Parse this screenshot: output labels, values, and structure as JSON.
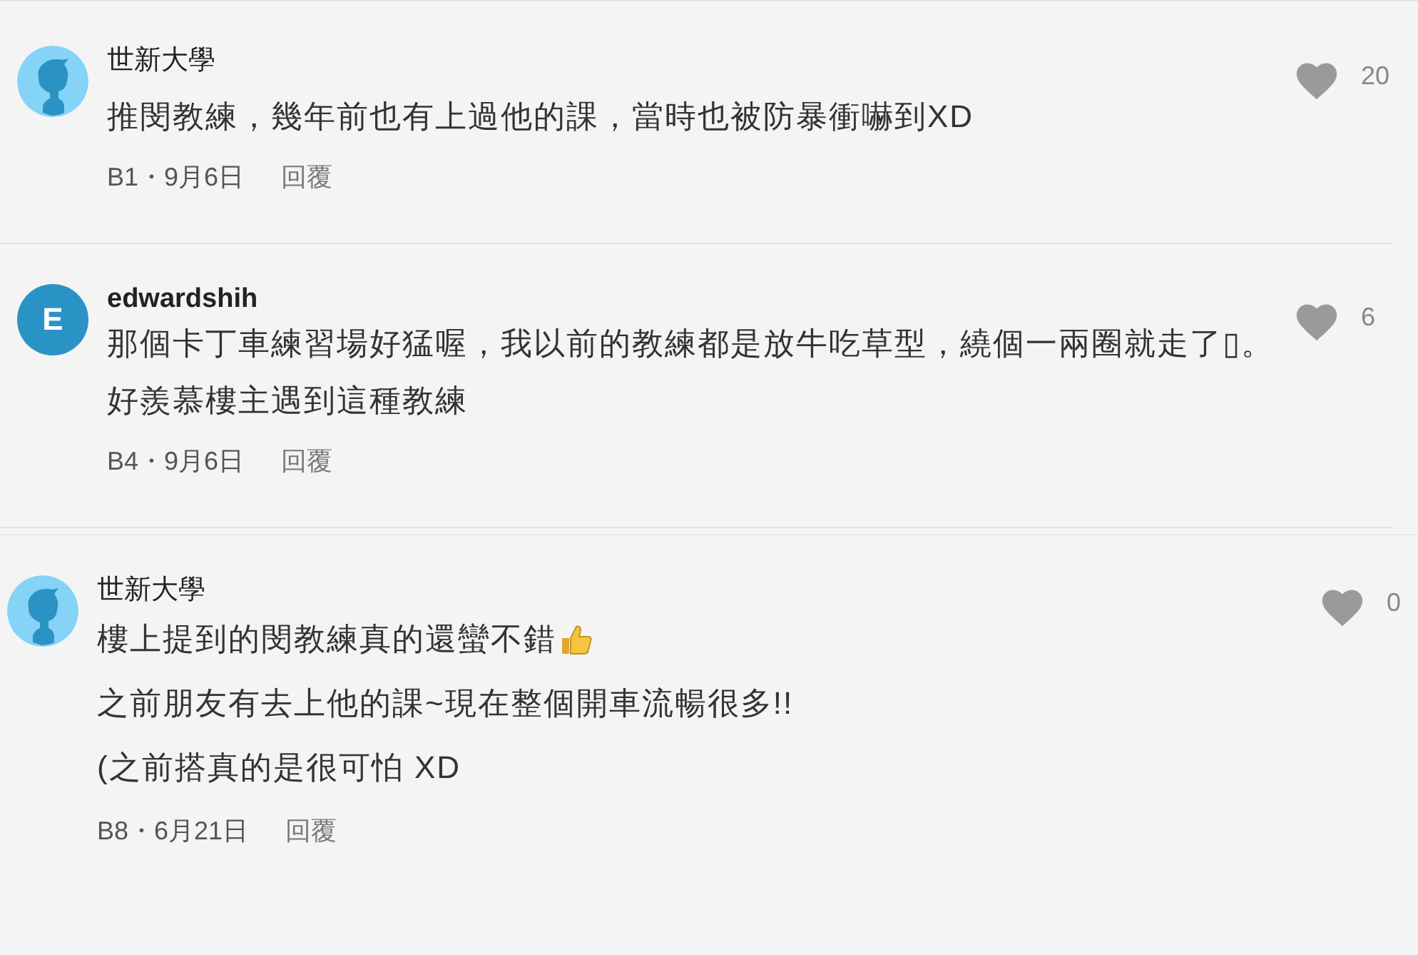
{
  "comments": [
    {
      "author": "世新大學",
      "avatar": {
        "kind": "silhouette"
      },
      "lines": [
        {
          "text": "推閔教練，幾年前也有上過他的課，當時也被防暴衝嚇到XD",
          "thumbs_up": false
        }
      ],
      "floor": "B1・9月6日",
      "reply": "回覆",
      "likes": "20"
    },
    {
      "author": "edwardshih",
      "avatar": {
        "kind": "letter",
        "letter": "E"
      },
      "lines": [
        {
          "text": "那個卡丁車練習場好猛喔，我以前的教練都是放牛吃草型，繞個一兩圈就走了▯。",
          "thumbs_up": false
        },
        {
          "text": "好羨慕樓主遇到這種教練",
          "thumbs_up": false
        }
      ],
      "floor": "B4・9月6日",
      "reply": "回覆",
      "likes": "6"
    },
    {
      "author": "世新大學",
      "avatar": {
        "kind": "silhouette"
      },
      "lines": [
        {
          "text": "樓上提到的閔教練真的還蠻不錯",
          "thumbs_up": true
        },
        {
          "text": "之前朋友有去上他的課~現在整個開車流暢很多!!",
          "thumbs_up": false
        },
        {
          "text": "(之前搭真的是很可怕 XD",
          "thumbs_up": false
        }
      ],
      "floor": "B8・6月21日",
      "reply": "回覆",
      "likes": "0"
    }
  ]
}
